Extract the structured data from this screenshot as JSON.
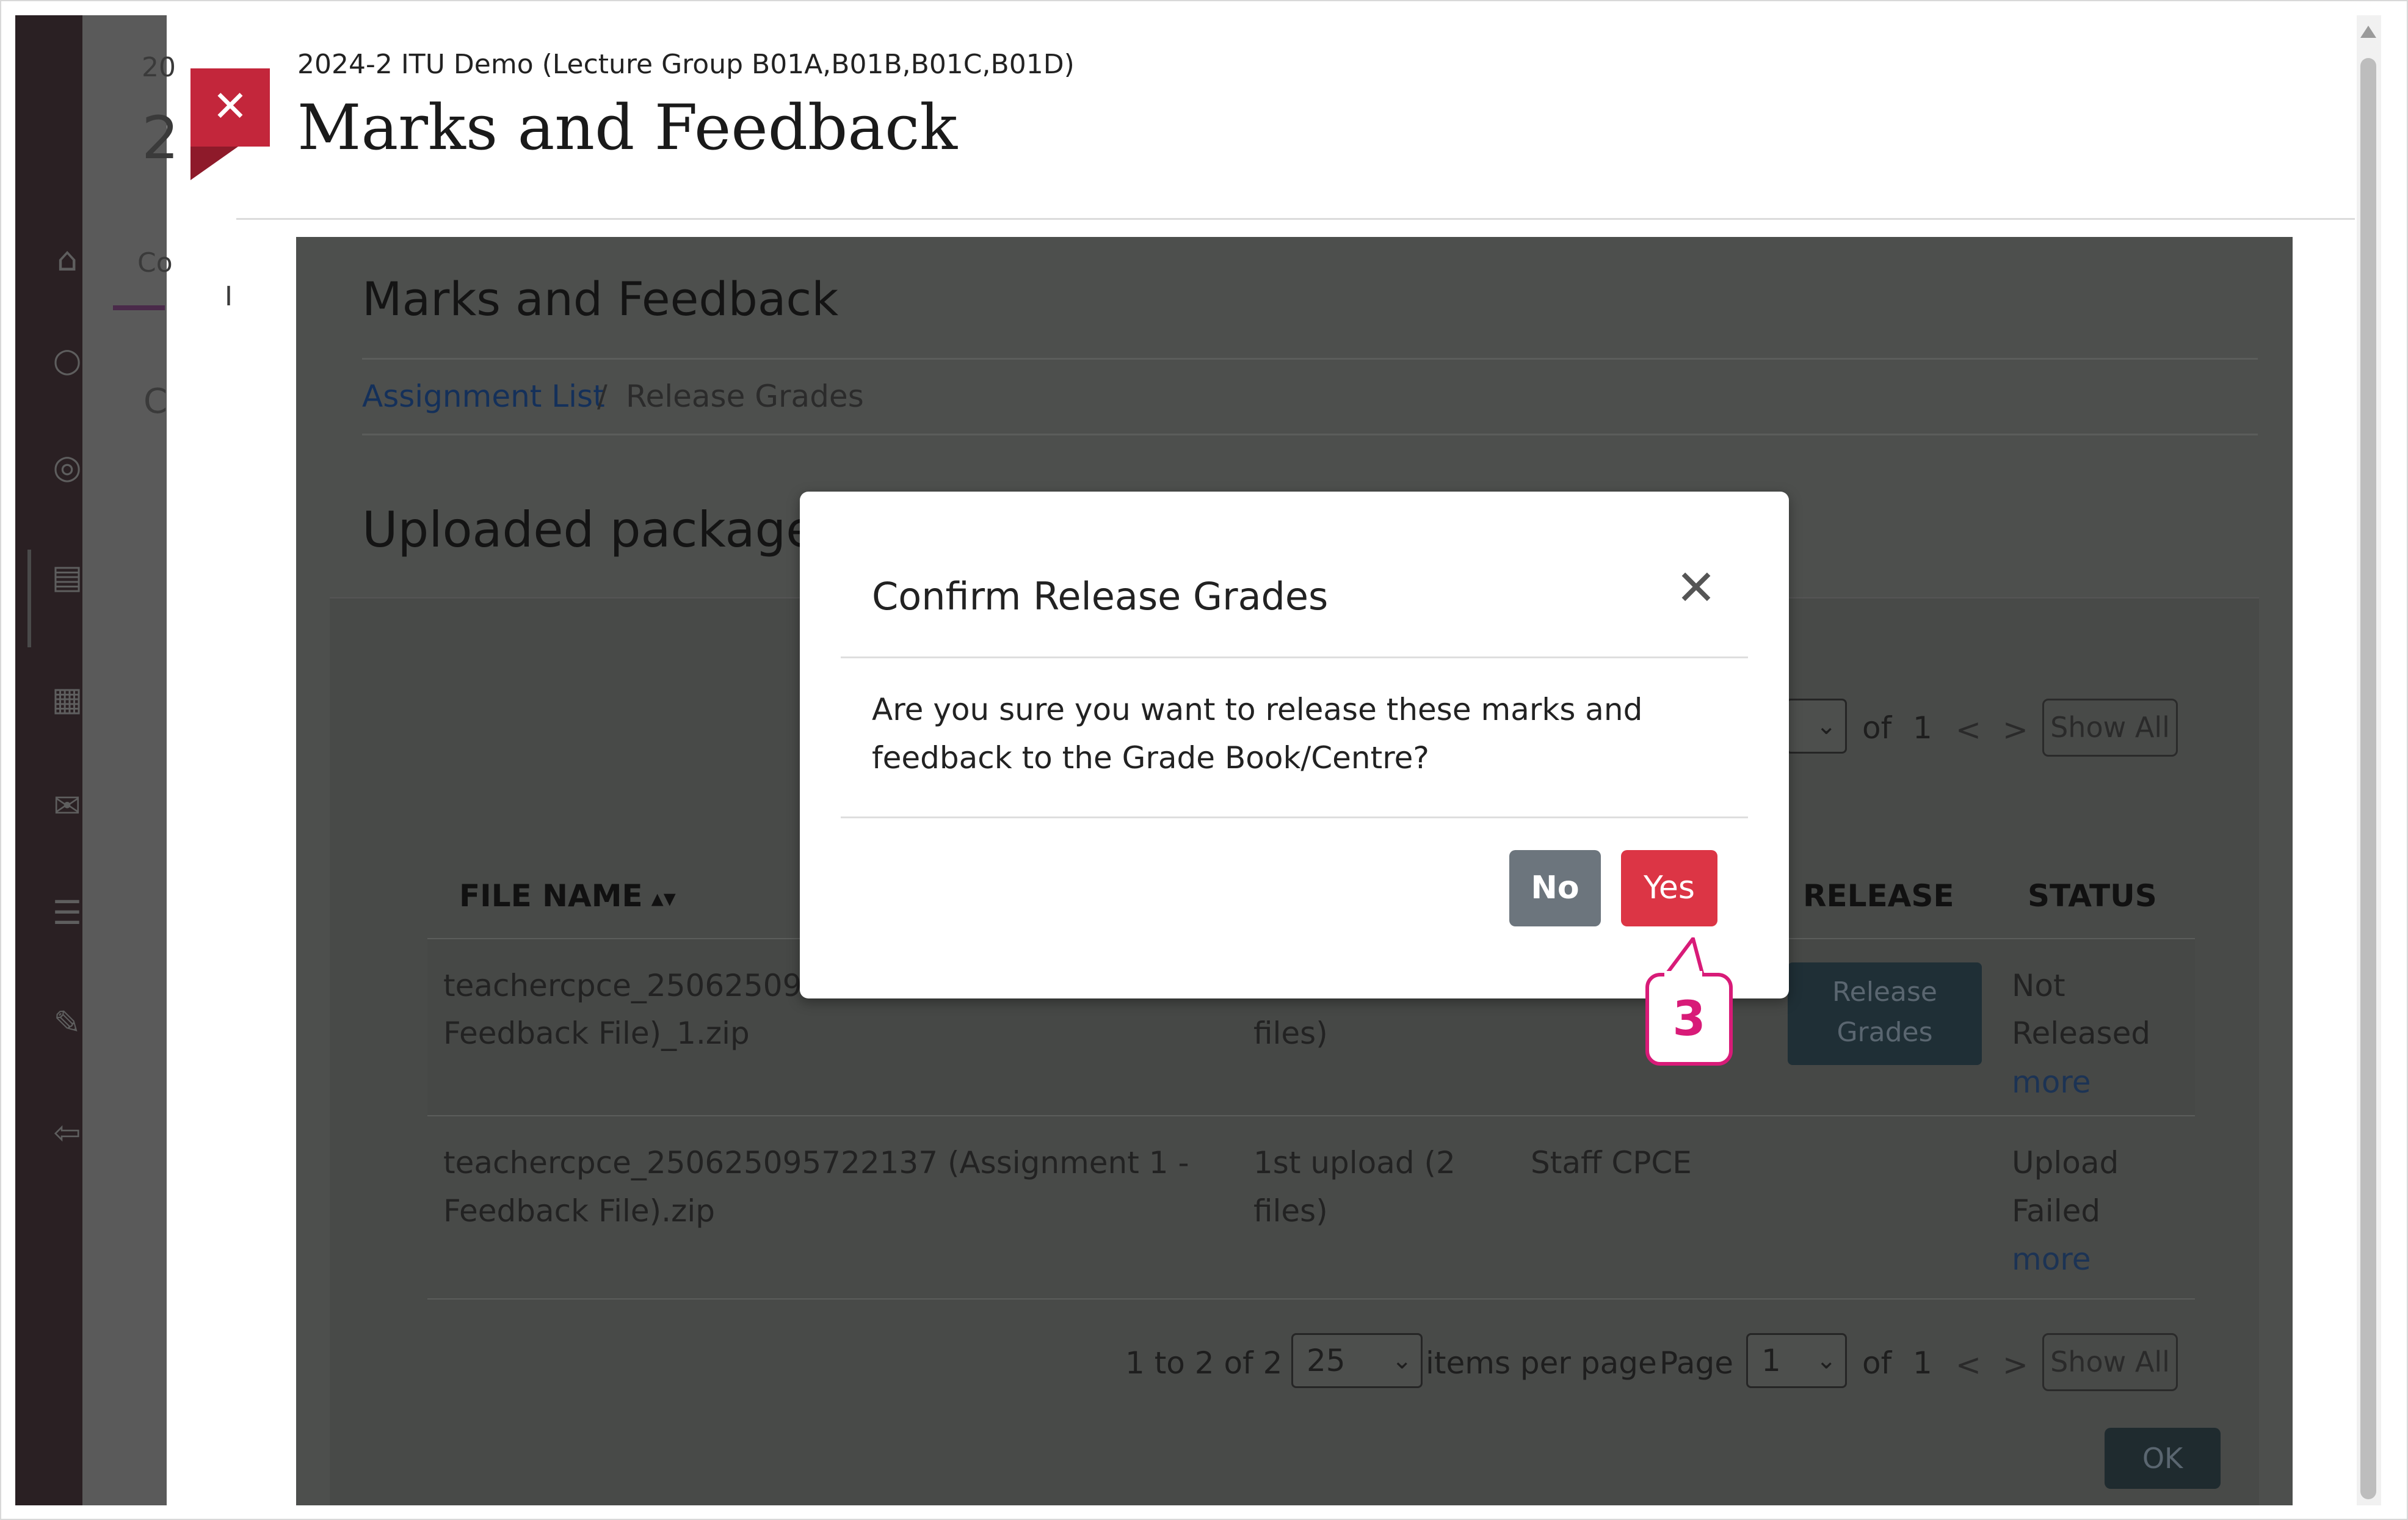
{
  "background": {
    "course_fragment": "20",
    "course_fragment_big": "2",
    "tab_fragment": "Co",
    "tab_fragment2": "I",
    "heading_fragment": "C"
  },
  "modal": {
    "course": "2024-2 ITU Demo (Lecture Group B01A,B01B,B01C,B01D)",
    "title": "Marks and Feedback",
    "close_symbol": "✕"
  },
  "page": {
    "heading": "Marks and Feedback",
    "breadcrumb": {
      "link": "Assignment List",
      "separator": "/",
      "current": "Release Grades"
    },
    "section_heading": "Uploaded packages f",
    "top_pager": {
      "of_label": "of",
      "total_pages": "1",
      "prev": "<",
      "next": ">",
      "show_all": "Show All"
    },
    "table": {
      "headers": {
        "file_name": "FILE NAME",
        "release": "RELEASE",
        "status": "STATUS"
      },
      "rows": [
        {
          "file_line1": "teachercpce_25062509572",
          "file_line2": "Feedback File)_1.zip",
          "upload_line2": "files)",
          "release_button": "Release Grades",
          "status_line1": "Not",
          "status_line2": "Released",
          "more": "more"
        },
        {
          "file_line1": "teachercpce_250625095722137 (Assignment 1 -",
          "file_line2": "Feedback File).zip",
          "upload_line1": "1st upload (2",
          "upload_line2": "files)",
          "uploader": "Staff CPCE",
          "status_line1": "Upload",
          "status_line2": "Failed",
          "more": "more"
        }
      ]
    },
    "bottom_pager": {
      "range": "1 to 2 of 2",
      "per_page_value": "25",
      "per_page_label": "items per page",
      "page_label": "Page",
      "page_value": "1",
      "of_label": "of",
      "total_pages": "1",
      "prev": "<",
      "next": ">",
      "show_all": "Show All"
    },
    "ok_button": "OK"
  },
  "dialog": {
    "title": "Confirm Release Grades",
    "close_symbol": "✕",
    "message": "Are you sure you want to release these marks and feedback to the Grade Book/Centre?",
    "no_label": "No",
    "yes_label": "Yes"
  },
  "callout": {
    "step": "3"
  },
  "colors": {
    "accent_red": "#dc3545",
    "secondary_gray": "#6c757d",
    "close_flag": "#c3263b",
    "callout_pink": "#d81b78"
  }
}
